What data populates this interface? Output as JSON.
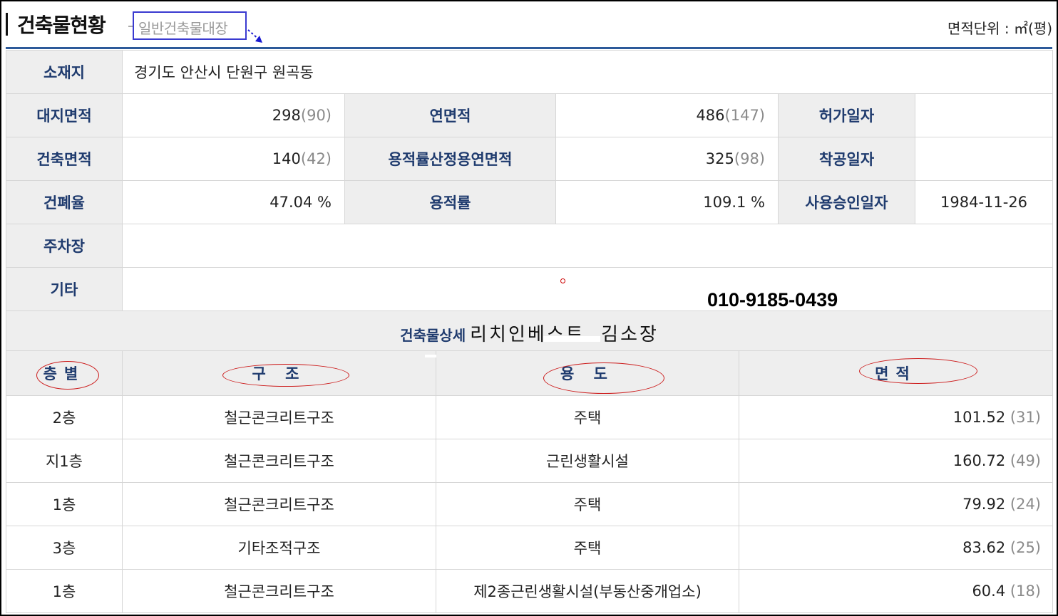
{
  "header": {
    "title": "건축물현황",
    "subtitle": "일반건축물대장",
    "unit": "면적단위 : ㎡(평)"
  },
  "info": {
    "location_label": "소재지",
    "location_value": "경기도 안산시 단원구 원곡동",
    "site_area_label": "대지면적",
    "site_area": "298",
    "site_area_py": "(90)",
    "total_floor_area_label": "연면적",
    "total_floor_area": "486",
    "total_floor_area_py": "(147)",
    "permit_date_label": "허가일자",
    "permit_date": "",
    "building_area_label": "건축면적",
    "building_area": "140",
    "building_area_py": "(42)",
    "far_floor_area_label": "용적률산정용연면적",
    "far_floor_area": "325",
    "far_floor_area_py": "(98)",
    "start_date_label": "착공일자",
    "start_date": "",
    "bcr_label": "건폐율",
    "bcr": "47.04 %",
    "far_label": "용적률",
    "far": "109.1 %",
    "approval_date_label": "사용승인일자",
    "approval_date": "1984-11-26",
    "parking_label": "주차장",
    "parking": "",
    "other_label": "기타",
    "other": ""
  },
  "detail": {
    "title": "건축물상세",
    "overlay_name": "리치인베스트 .김소장",
    "overlay_phone": "010-9185-0439"
  },
  "floors": {
    "headers": [
      "층별",
      "구 조",
      "용 도",
      "면적"
    ],
    "rows": [
      {
        "floor": "2층",
        "structure": "철근콘크리트구조",
        "use": "주택",
        "area": "101.52",
        "area_py": "(31)"
      },
      {
        "floor": "지1층",
        "structure": "철근콘크리트구조",
        "use": "근린생활시설",
        "area": "160.72",
        "area_py": "(49)"
      },
      {
        "floor": "1층",
        "structure": "철근콘크리트구조",
        "use": "주택",
        "area": "79.92",
        "area_py": "(24)"
      },
      {
        "floor": "3층",
        "structure": "기타조적구조",
        "use": "주택",
        "area": "83.62",
        "area_py": "(25)"
      },
      {
        "floor": "1층",
        "structure": "철근콘크리트구조",
        "use": "제2종근린생활시설(부동산중개업소)",
        "area": "60.4",
        "area_py": "(18)"
      }
    ]
  },
  "colors": {
    "label_text": "#1f3b6e",
    "label_bg": "#eeeeee",
    "rule_blue": "#2d5a9a",
    "annotation_red": "#cc1a1a",
    "annotation_blue": "#3a3ad0"
  }
}
